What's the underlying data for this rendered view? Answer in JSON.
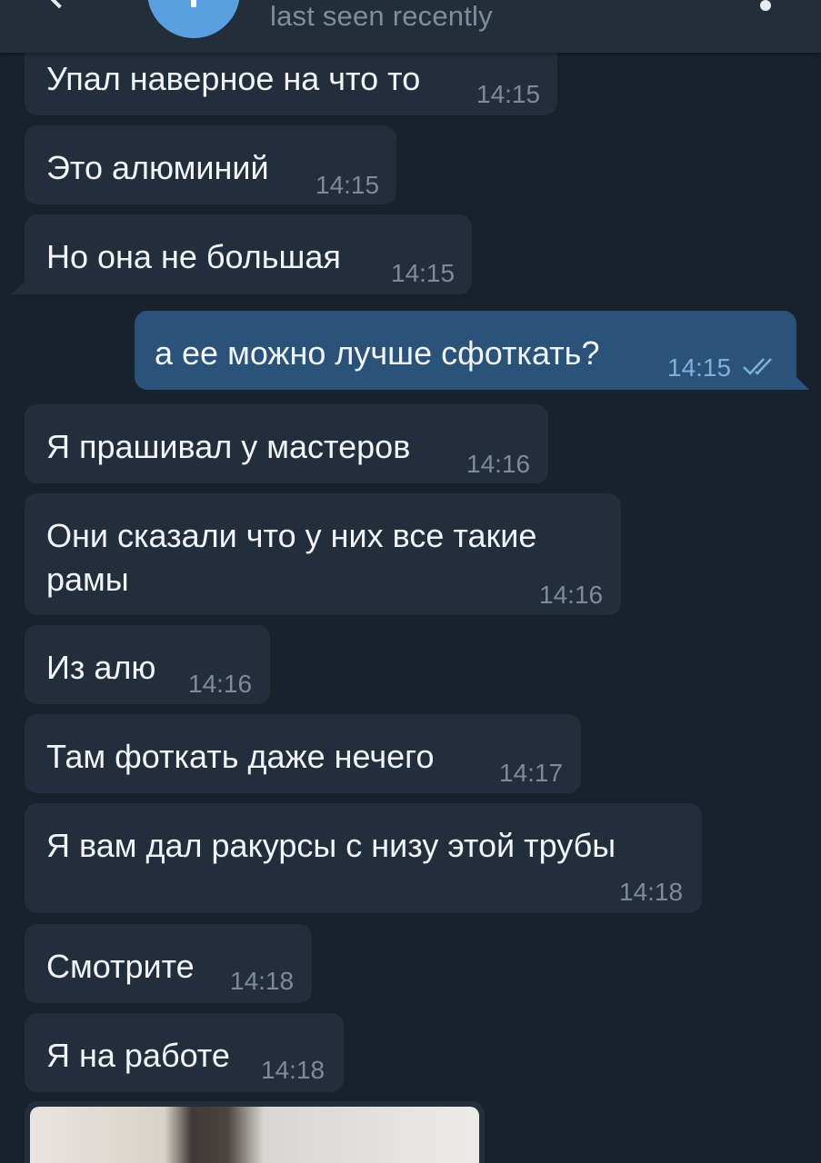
{
  "header": {
    "status": "last seen recently"
  },
  "messages": [
    {
      "text": "Упал наверное на что то",
      "time": "14:15",
      "dir": "in"
    },
    {
      "text": "Это алюминий",
      "time": "14:15",
      "dir": "in"
    },
    {
      "text": "Но она не большая",
      "time": "14:15",
      "dir": "in"
    },
    {
      "text": "а ее можно лучше сфоткать?",
      "time": "14:15",
      "dir": "out",
      "read": true
    },
    {
      "text": "Я прашивал у мастеров",
      "time": "14:16",
      "dir": "in"
    },
    {
      "text_line1": "Они сказали что у них все такие",
      "text_line2": "рамы",
      "time": "14:16",
      "dir": "in"
    },
    {
      "text": "Из алю",
      "time": "14:16",
      "dir": "in"
    },
    {
      "text": "Там фоткать даже нечего",
      "time": "14:17",
      "dir": "in"
    },
    {
      "text": "Я вам дал ракурсы с низу этой трубы",
      "time": "14:18",
      "dir": "in"
    },
    {
      "text": "Смотрите",
      "time": "14:18",
      "dir": "in"
    },
    {
      "text": "Я на работе",
      "time": "14:18",
      "dir": "in"
    }
  ],
  "colors": {
    "background": "#18222d",
    "incoming_bubble": "#232e3c",
    "outgoing_bubble": "#2b5278",
    "read_check": "#7fb0dc"
  },
  "icons": [
    "back-arrow-icon",
    "more-vert-icon",
    "double-check-icon"
  ]
}
